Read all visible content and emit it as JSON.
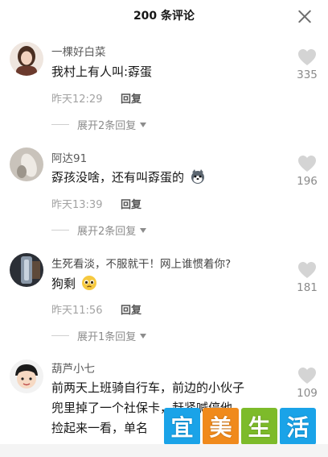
{
  "header": {
    "title": "200 条评论"
  },
  "comments": [
    {
      "username": "一棵好白菜",
      "text": "我村上有人叫:孬蛋",
      "time": "昨天12:29",
      "reply_label": "回复",
      "expand_label": "展开2条回复",
      "likes": "335"
    },
    {
      "username": "阿达91",
      "text": "孬孩没啥，还有叫孬蛋的",
      "emoji": "husky-emoji",
      "time": "昨天13:39",
      "reply_label": "回复",
      "expand_label": "展开2条回复",
      "likes": "196"
    },
    {
      "username": "生死看淡，不服就干！网上谁惯着你?",
      "text": "狗剩",
      "emoji": "pleading-face-emoji",
      "time": "昨天11:56",
      "reply_label": "回复",
      "expand_label": "展开1条回复",
      "likes": "181"
    },
    {
      "username": "葫芦小七",
      "text_lines": [
        "前两天上班骑自行车，前边的小伙子",
        "兜里掉了一个社保卡，赶紧喊停他，",
        "捡起来一看，单名"
      ],
      "likes": "109"
    }
  ],
  "watermark": {
    "chars": [
      "宜",
      "美",
      "生",
      "活"
    ],
    "colors": [
      "#1aa3e8",
      "#f08a1c",
      "#7dbb2a",
      "#1aa3e8"
    ]
  },
  "icons": {
    "close": "close-icon",
    "like": "heart-icon"
  }
}
